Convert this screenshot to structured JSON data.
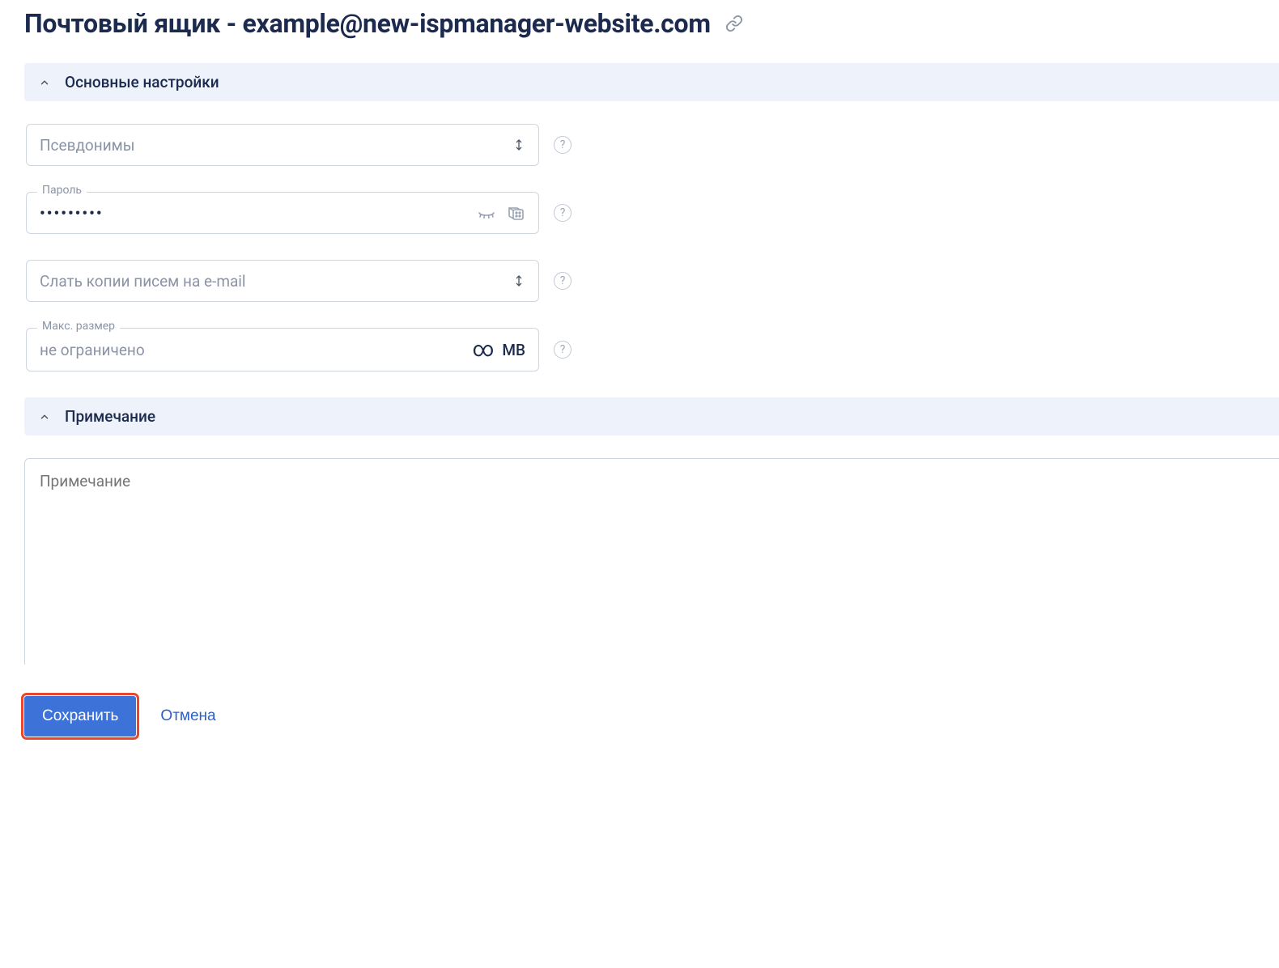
{
  "header": {
    "title": "Почтовый ящик - example@new-ispmanager-website.com"
  },
  "sections": {
    "main": {
      "title": "Основные настройки"
    },
    "note": {
      "title": "Примечание"
    }
  },
  "fields": {
    "aliases": {
      "placeholder": "Псевдонимы"
    },
    "password": {
      "label": "Пароль",
      "value": "•••••••••"
    },
    "forward": {
      "placeholder": "Слать копии писем на e-mail"
    },
    "maxsize": {
      "label": "Макс. размер",
      "placeholder": "не ограничено",
      "unit": "MB"
    },
    "note": {
      "placeholder": "Примечание"
    }
  },
  "buttons": {
    "save": "Сохранить",
    "cancel": "Отмена"
  },
  "help": "?"
}
